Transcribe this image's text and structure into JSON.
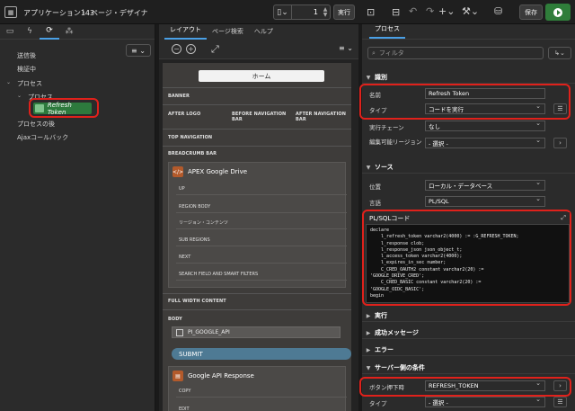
{
  "topbar": {
    "app_title": "アプリケーション143",
    "separator": "\\",
    "page_title": "ページ・デザイナ",
    "page_number": "1",
    "run_label": "実行",
    "save_label": "保存"
  },
  "left": {
    "tree": {
      "items": [
        {
          "label": "送信後"
        },
        {
          "label": "検証中"
        },
        {
          "label": "プロセス"
        },
        {
          "label": "プロセス"
        },
        {
          "label": "Refresh Token"
        },
        {
          "label": "プロセスの後"
        },
        {
          "label": "Ajaxコールバック"
        }
      ]
    }
  },
  "middle": {
    "tabs": [
      "レイアウト",
      "ページ検索",
      "ヘルプ"
    ],
    "home_label": "ホーム",
    "sections": {
      "banner": "BANNER",
      "after_logo": "AFTER LOGO",
      "before_nav": "BEFORE NAVIGATION BAR",
      "after_nav": "AFTER NAVIGATION BAR",
      "top_nav": "TOP NAVIGATION",
      "breadcrumb": "BREADCRUMB BAR",
      "full_width": "FULL WIDTH CONTENT",
      "body": "BODY"
    },
    "region1": {
      "title": "APEX Google Drive",
      "slots": [
        "UP",
        "REGION BODY",
        "リージョン・コンテンツ",
        "SUB REGIONS",
        "NEXT",
        "SEARCH FIELD AND SMART FILTERS"
      ]
    },
    "item": "PI_GOOGLE_API",
    "submit_label": "SUBMIT",
    "region2": {
      "title": "Google API Response",
      "slots": [
        "COPY",
        "EDIT"
      ]
    }
  },
  "right": {
    "tab": "プロセス",
    "filter_placeholder": "フィルタ",
    "groups": {
      "identification": "識別",
      "source": "ソース",
      "execute": "実行",
      "success": "成功メッセージ",
      "error": "エラー",
      "server_condition": "サーバー側の条件"
    },
    "props": {
      "name_label": "名前",
      "name_value": "Refresh Token",
      "type_label": "タイプ",
      "type_value": "コードを実行",
      "chain_label": "実行チェーン",
      "chain_value": "なし",
      "editable_label": "編集可能リージョン",
      "editable_value": "- 選択 -",
      "location_label": "位置",
      "location_value": "ローカル・データベース",
      "language_label": "言語",
      "language_value": "PL/SQL",
      "code_label": "PL/SQLコード",
      "button_label": "ボタン押下時",
      "button_value": "REFRESH_TOKEN",
      "type2_label": "タイプ",
      "type2_value": "- 選択 -"
    },
    "code_lines": [
      "declare",
      "    l_refresh_token varchar2(4000) := :G_REFRESH_TOKEN;",
      "    l_response clob;",
      "    l_response_json json_object_t;",
      "    l_access_token varchar2(4000);",
      "    l_expires_in_sec number;",
      "    C_CRED_OAUTH2 constant varchar2(20) :=",
      "'GOOGLE_DRIVE_CRED';",
      "    C_CRED_BASIC constant varchar2(20) :=",
      "'GOOGLE_OIDC_BASIC';",
      "begin"
    ]
  }
}
